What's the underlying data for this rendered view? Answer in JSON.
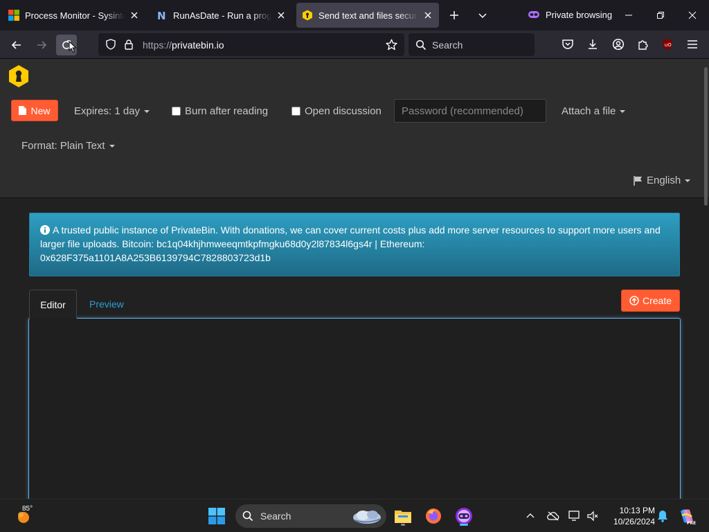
{
  "tabs": [
    {
      "title": "Process Monitor - Sysinternals",
      "favicon": "windows-logo-icon",
      "active": false
    },
    {
      "title": "RunAsDate - Run a program with a date",
      "favicon": "n-letter-icon",
      "active": false
    },
    {
      "title": "Send text and files securely and anonymously",
      "favicon": "privatebin-icon",
      "active": true
    }
  ],
  "private_label": "Private browsing",
  "url": {
    "scheme": "https://",
    "host": "privatebin.io"
  },
  "search_placeholder": "Search",
  "app": {
    "new_label": "New",
    "expires_label": "Expires: 1 day",
    "burn_label": "Burn after reading",
    "discussion_label": "Open discussion",
    "password_placeholder": "Password (recommended)",
    "attach_label": "Attach a file",
    "format_label": "Format: Plain Text",
    "language_label": "English",
    "alert_line1": "A trusted public instance of PrivateBin. With donations, we can cover current costs plus add more server resources to support more users and larger file uploads. Bitcoin: bc1q04khjhmweeqmtkpfmgku68d0y2l87834l6gs4r | Ethereum:",
    "alert_line2": "0x628F375a1101A8A253B6139794C7828803723d1b",
    "tab_editor": "Editor",
    "tab_preview": "Preview",
    "create_label": "Create",
    "editor_text": ""
  },
  "taskbar": {
    "temperature": "85°",
    "search_placeholder": "Search",
    "time": "10:13 PM",
    "date": "10/26/2024"
  },
  "colors": {
    "accent_button": "#ff5c33",
    "alert_bg": "#2e9fc2",
    "link": "#2a9fd6",
    "logo_yellow": "#ffcc00"
  }
}
